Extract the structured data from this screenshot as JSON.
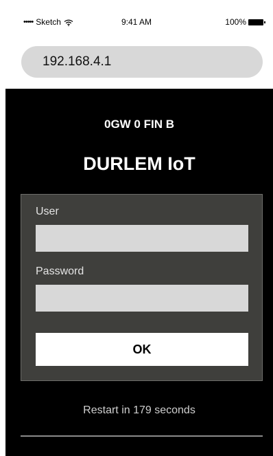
{
  "status_bar": {
    "carrier_dots": "•••••",
    "carrier": "Sketch",
    "wifi_icon": "wifi-icon",
    "time": "9:41 AM",
    "battery_percent": "100%",
    "battery_icon": "battery-icon"
  },
  "browser": {
    "url": "192.168.4.1"
  },
  "page": {
    "device_id": "0GW 0 FIN B",
    "title": "DURLEM IoT",
    "form": {
      "user_label": "User",
      "user_value": "",
      "password_label": "Password",
      "password_value": "",
      "ok_label": "OK"
    },
    "restart_text": "Restart in 179 seconds"
  },
  "colors": {
    "background": "#000000",
    "panel": "#3f3f3c",
    "input": "#d8d8d8",
    "button": "#ffffff"
  }
}
